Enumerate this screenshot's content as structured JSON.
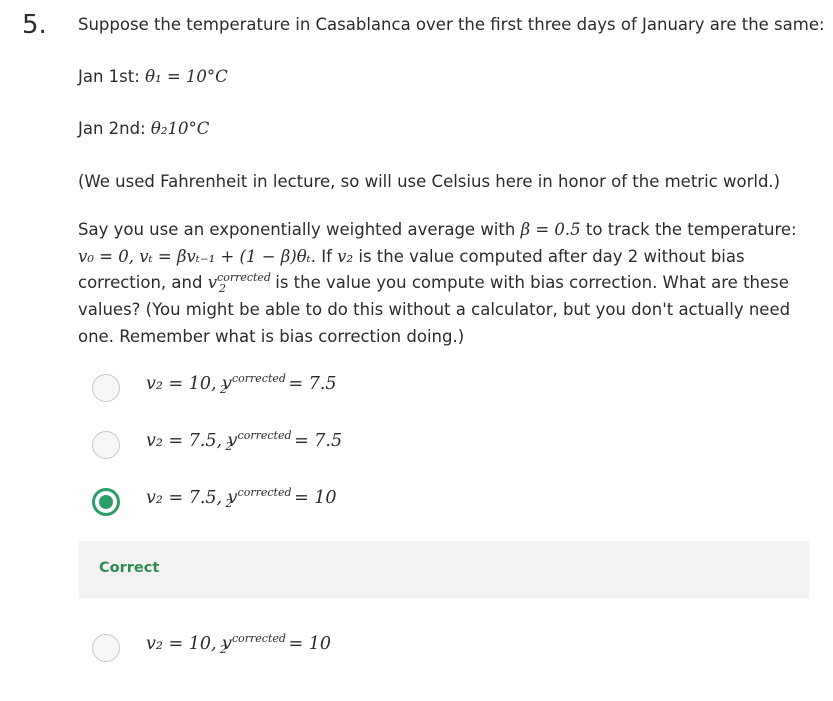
{
  "question": {
    "number": "5.",
    "prompt": "Suppose the temperature in Casablanca over the first three days of January are the same:",
    "jan1_label": "Jan 1st: ",
    "jan1_math": "θ₁ = 10°C",
    "jan2_label": "Jan 2nd: ",
    "jan2_math": "θ₂10°C",
    "note": "(We used Fahrenheit in lecture, so will use Celsius here in honor of the metric world.)",
    "body_1": "Say you use an exponentially weighted average with ",
    "beta_math": "β = 0.5",
    "body_2": " to track the temperature:",
    "formula_math": "v₀ = 0, vₜ = βvₜ₋₁ + (1 − β)θₜ",
    "body_3": ". If ",
    "v2_math": "v₂",
    "body_4": " is the value computed after day 2 without bias",
    "body_5": "correction, and ",
    "vcorr_base": "v",
    "vcorr_sup": "corrected",
    "vcorr_sub": "2",
    "body_6": " is the value you compute with bias correction. What are these",
    "body_7": "values? (You might be able to do this without a calculator, but you don't actually need",
    "body_8": "one. Remember what is bias correction doing.)"
  },
  "options": [
    {
      "left": "v₂ = 10, v",
      "sup": "corrected",
      "sub": "2",
      "right": " = 7.5",
      "selected": false
    },
    {
      "left": "v₂ = 7.5, v",
      "sup": "corrected",
      "sub": "2",
      "right": " = 7.5",
      "selected": false
    },
    {
      "left": "v₂ = 7.5, v",
      "sup": "corrected",
      "sub": "2",
      "right": " = 10",
      "selected": true
    },
    {
      "left": "v₂ = 10, v",
      "sup": "corrected",
      "sub": "2",
      "right": " = 10",
      "selected": false
    }
  ],
  "feedback": {
    "text": "Correct"
  },
  "colors": {
    "accent": "#2a9d68",
    "correct_text": "#2f8a52",
    "feedback_bg": "#f2f2f2"
  }
}
